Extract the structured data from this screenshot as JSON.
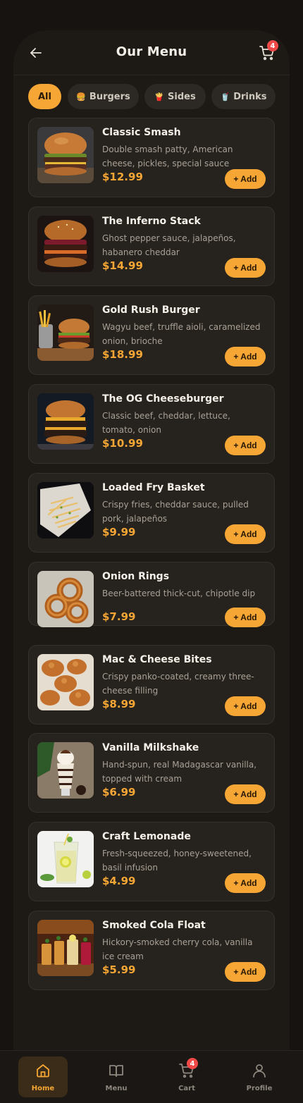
{
  "header": {
    "title": "Our Menu",
    "cart_count": "4"
  },
  "tabs": [
    {
      "label": "All",
      "icon": "",
      "active": true
    },
    {
      "label": "Burgers",
      "icon": "🍔",
      "active": false
    },
    {
      "label": "Sides",
      "icon": "🍟",
      "active": false
    },
    {
      "label": "Drinks",
      "icon": "🥤",
      "active": false
    }
  ],
  "add_label": "+ Add",
  "items": [
    {
      "name": "Classic Smash",
      "desc": "Double smash patty, American cheese, pickles, special sauce",
      "price": "$12.99",
      "image": "burger-photo"
    },
    {
      "name": "The Inferno Stack",
      "desc": "Ghost pepper sauce, jalapeños, habanero cheddar",
      "price": "$14.99",
      "image": "burger-photo"
    },
    {
      "name": "Gold Rush Burger",
      "desc": "Wagyu beef, truffle aioli, caramelized onion, brioche",
      "price": "$18.99",
      "image": "burger-fries-photo"
    },
    {
      "name": "The OG Cheeseburger",
      "desc": "Classic beef, cheddar, lettuce, tomato, onion",
      "price": "$10.99",
      "image": "burger-photo"
    },
    {
      "name": "Loaded Fry Basket",
      "desc": "Crispy fries, cheddar sauce, pulled pork, jalapeños",
      "price": "$9.99",
      "image": "fries-photo"
    },
    {
      "name": "Onion Rings",
      "desc": "Beer-battered thick-cut, chipotle dip",
      "price": "$7.99",
      "image": "onion-rings-photo"
    },
    {
      "name": "Mac & Cheese Bites",
      "desc": "Crispy panko-coated, creamy three-cheese filling",
      "price": "$8.99",
      "image": "bites-photo"
    },
    {
      "name": "Vanilla Milkshake",
      "desc": "Hand-spun, real Madagascar vanilla, topped with cream",
      "price": "$6.99",
      "image": "milkshake-photo"
    },
    {
      "name": "Craft Lemonade",
      "desc": "Fresh-squeezed, honey-sweetened, basil infusion",
      "price": "$4.99",
      "image": "lemonade-photo"
    },
    {
      "name": "Smoked Cola Float",
      "desc": "Hickory-smoked cherry cola, vanilla ice cream",
      "price": "$5.99",
      "image": "cola-float-photo"
    }
  ],
  "nav": [
    {
      "label": "Home",
      "icon": "home-icon",
      "active": true
    },
    {
      "label": "Menu",
      "icon": "book-icon",
      "active": false
    },
    {
      "label": "Cart",
      "icon": "cart-icon",
      "active": false,
      "badge": "4"
    },
    {
      "label": "Profile",
      "icon": "user-icon",
      "active": false
    }
  ],
  "colors": {
    "accent": "#f6a634",
    "background": "#161310",
    "card": "#26221e",
    "badge": "#ef4a48"
  }
}
